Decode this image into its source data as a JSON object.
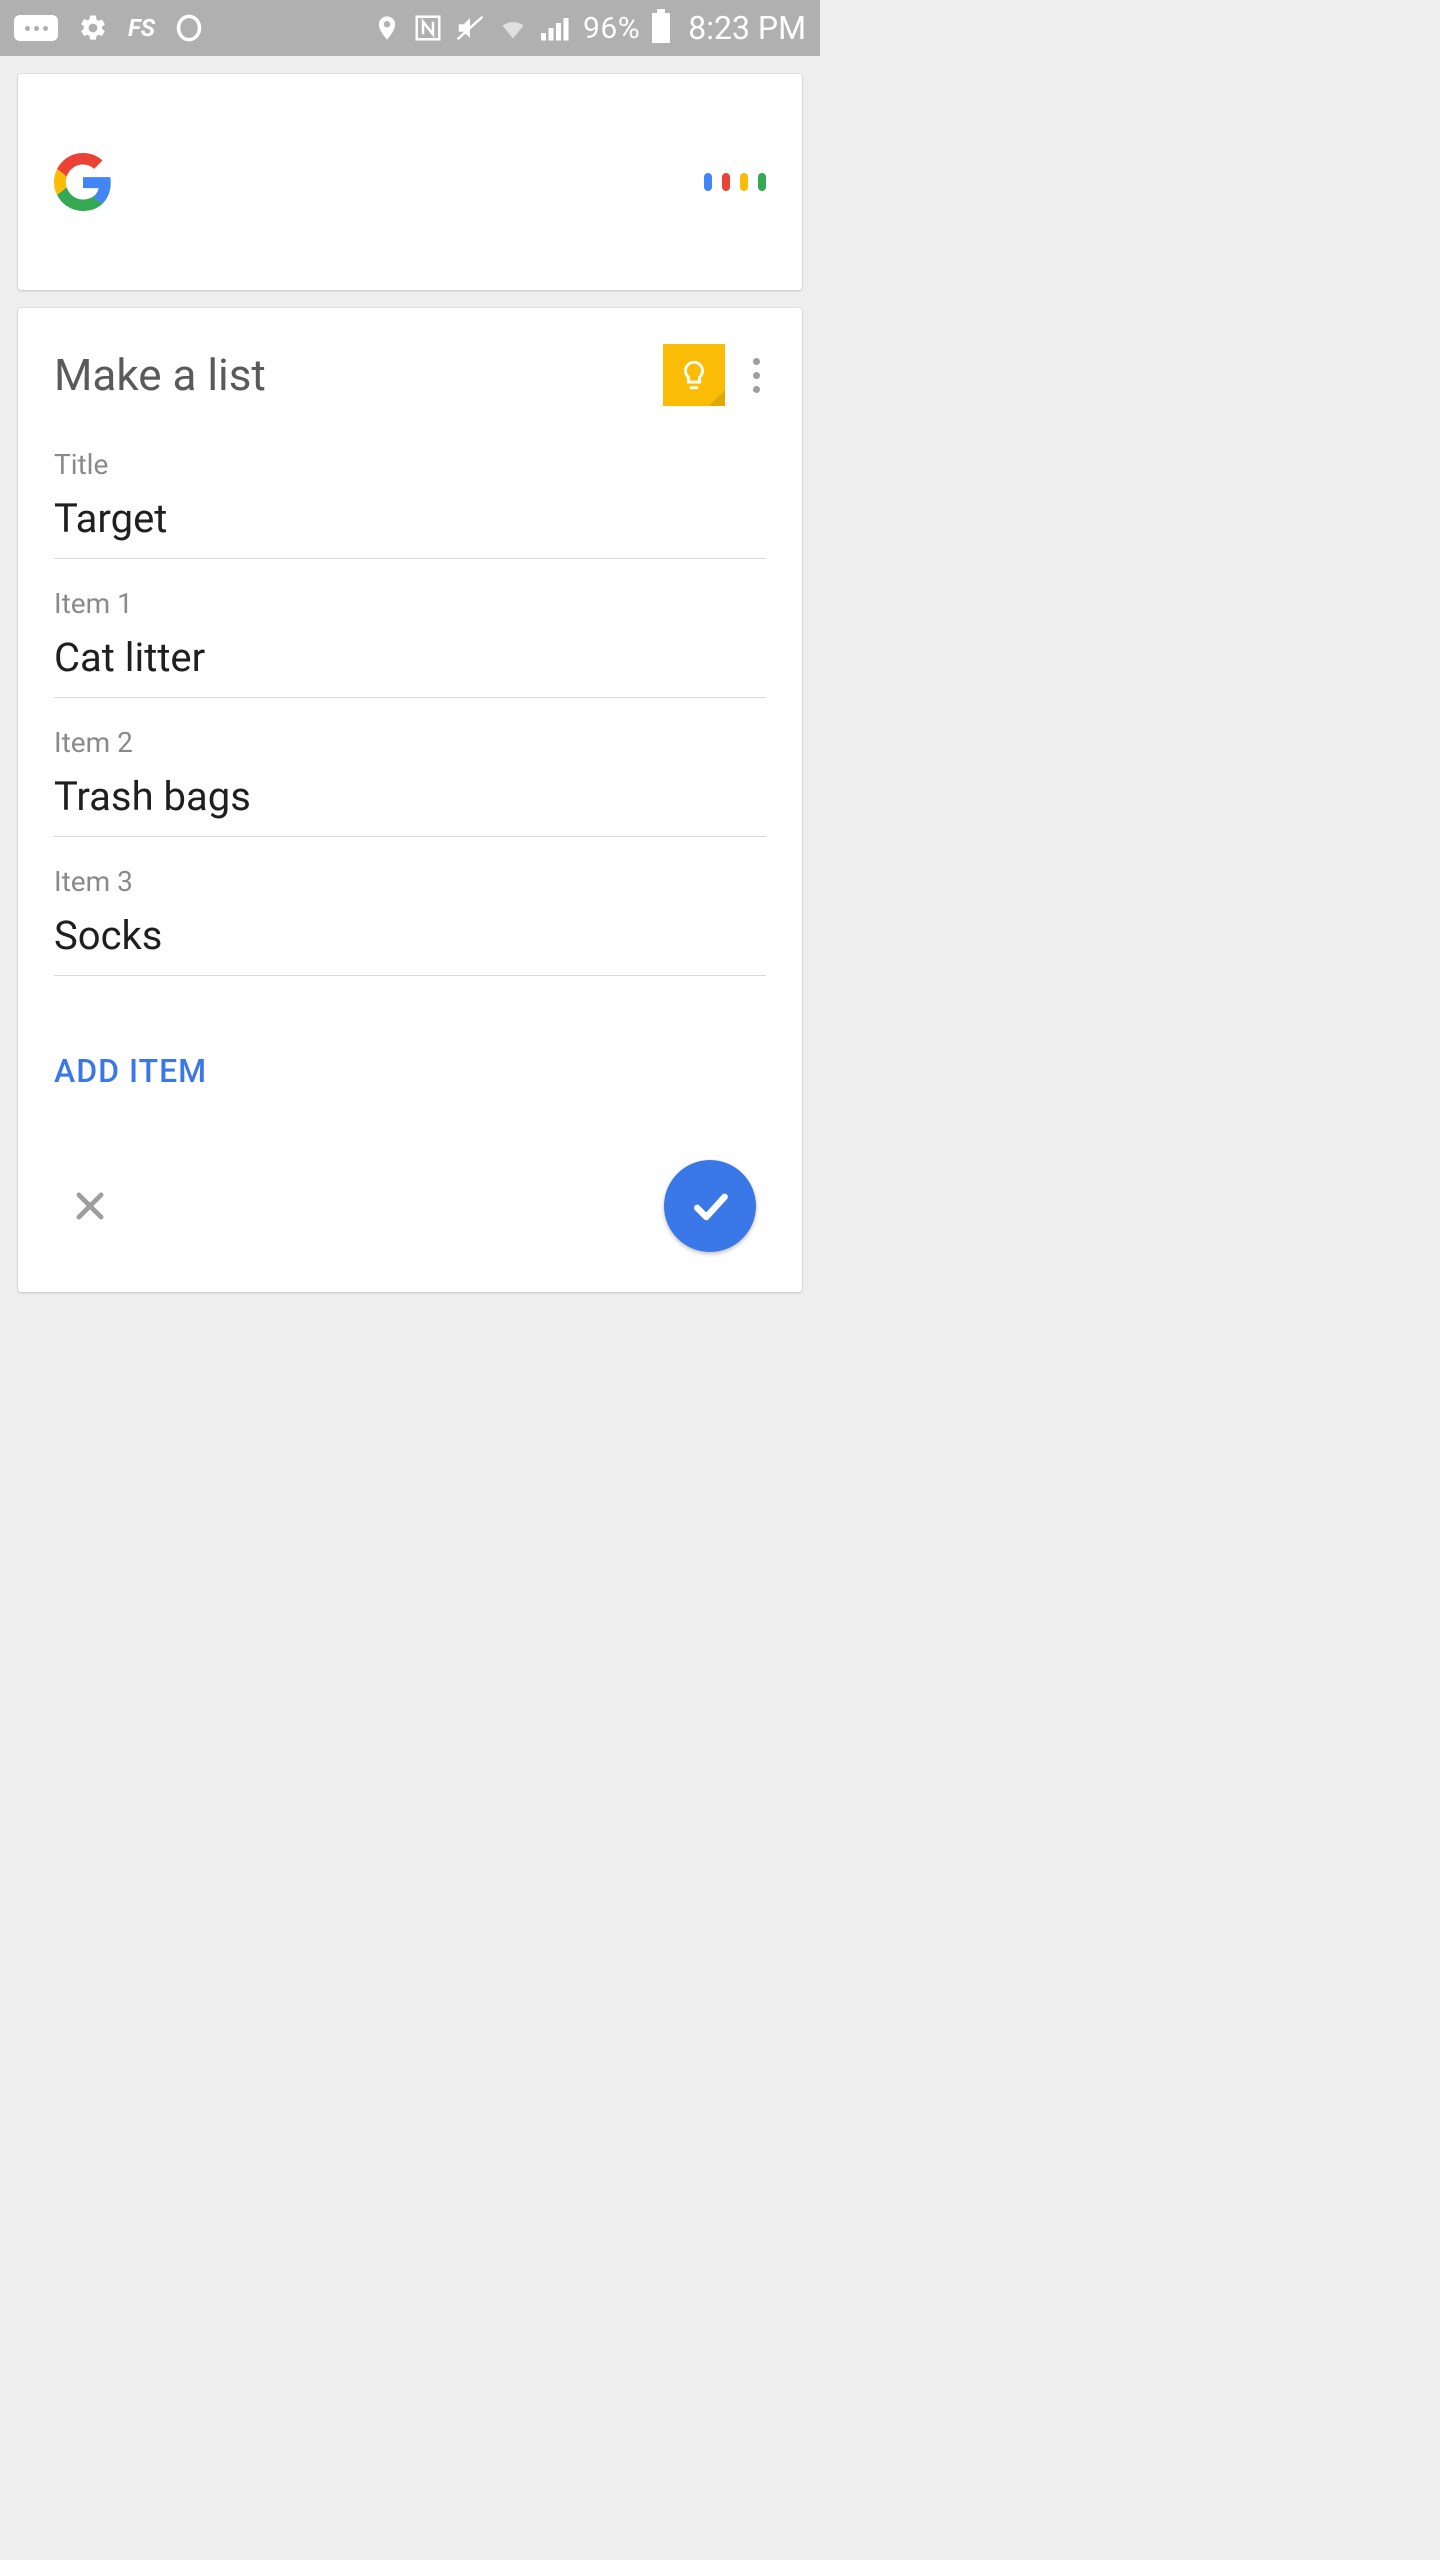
{
  "statusbar": {
    "battery_pct": "96%",
    "time": "8:23 PM"
  },
  "list_card": {
    "heading": "Make a list",
    "title_label": "Title",
    "title_value": "Target",
    "items": [
      {
        "label": "Item 1",
        "value": "Cat litter"
      },
      {
        "label": "Item 2",
        "value": "Trash bags"
      },
      {
        "label": "Item 3",
        "value": "Socks"
      }
    ],
    "add_item_label": "ADD ITEM"
  }
}
